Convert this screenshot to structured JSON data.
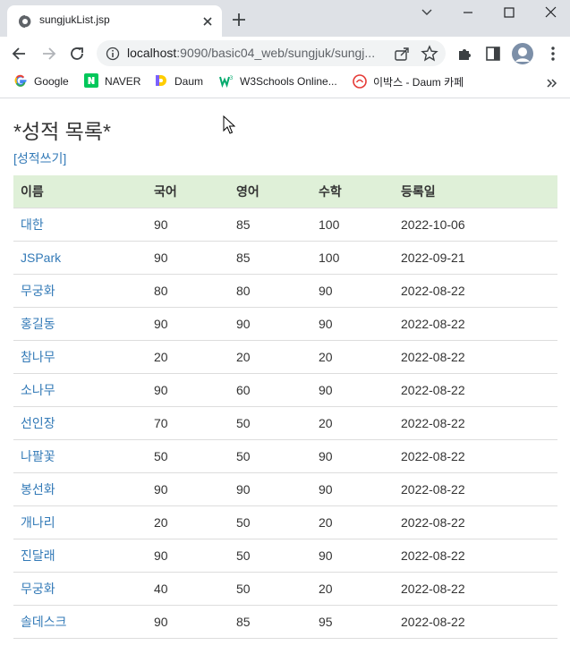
{
  "browser": {
    "tab_title": "sungjukList.jsp",
    "url_host": "localhost",
    "url_path": ":9090/basic04_web/sungjuk/sungj...",
    "bookmarks": [
      {
        "label": "Google",
        "icon": "google-icon"
      },
      {
        "label": "NAVER",
        "icon": "naver-icon"
      },
      {
        "label": "Daum",
        "icon": "daum-icon"
      },
      {
        "label": "W3Schools Online...",
        "icon": "w3schools-icon"
      },
      {
        "label": "이박스 - Daum 카페",
        "icon": "daum-cafe-icon"
      }
    ]
  },
  "page": {
    "title": "*성적 목록*",
    "write_link": "[성적쓰기]",
    "columns": [
      "이름",
      "국어",
      "영어",
      "수학",
      "등록일"
    ],
    "rows": [
      [
        "대한",
        "90",
        "85",
        "100",
        "2022-10-06"
      ],
      [
        "JSPark",
        "90",
        "85",
        "100",
        "2022-09-21"
      ],
      [
        "무궁화",
        "80",
        "80",
        "90",
        "2022-08-22"
      ],
      [
        "홍길동",
        "90",
        "90",
        "90",
        "2022-08-22"
      ],
      [
        "참나무",
        "20",
        "20",
        "20",
        "2022-08-22"
      ],
      [
        "소나무",
        "90",
        "60",
        "90",
        "2022-08-22"
      ],
      [
        "선인장",
        "70",
        "50",
        "20",
        "2022-08-22"
      ],
      [
        "나팔꽃",
        "50",
        "50",
        "90",
        "2022-08-22"
      ],
      [
        "봉선화",
        "90",
        "90",
        "90",
        "2022-08-22"
      ],
      [
        "개나리",
        "20",
        "50",
        "20",
        "2022-08-22"
      ],
      [
        "진달래",
        "90",
        "50",
        "90",
        "2022-08-22"
      ],
      [
        "무궁화",
        "40",
        "50",
        "20",
        "2022-08-22"
      ],
      [
        "솔데스크",
        "90",
        "85",
        "95",
        "2022-08-22"
      ]
    ]
  },
  "colors": {
    "header_bg": "#dff0d8",
    "link": "#337ab7",
    "tabstrip": "#dee1e6"
  }
}
